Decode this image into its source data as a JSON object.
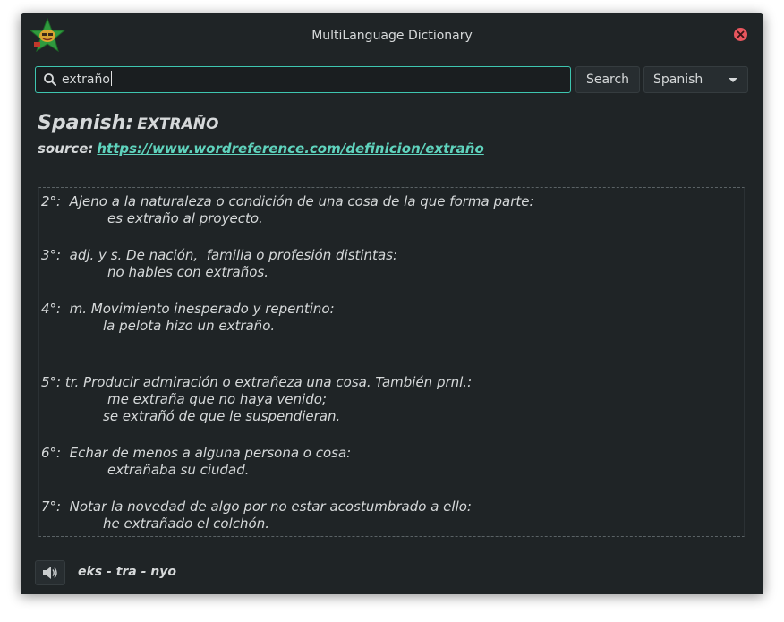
{
  "window": {
    "title": "MultiLanguage Dictionary"
  },
  "search": {
    "query": "extraño",
    "button_label": "Search",
    "language": "Spanish"
  },
  "result": {
    "language_label": "Spanish:",
    "word": "EXTRAÑO",
    "source_label": "source:",
    "source_url": "https://www.wordreference.com/definicion/extraño"
  },
  "definitions": [
    "2°:  Ajeno a la naturaleza o condición de una cosa de la que forma parte:",
    "es extraño al proyecto.",
    "3°:  adj. y s. De nación,  familia o profesión distintas:",
    "no hables con extraños.",
    "4°:  m. Movimiento inesperado y repentino:",
    "la pelota hizo un extraño.",
    "5°: tr. Producir admiración o extrañeza una cosa. También prnl.:",
    "me extraña que no haya venido;",
    "se extrañó de que le suspendieran.",
    "6°:  Echar de menos a alguna persona o cosa:",
    "extrañaba su ciudad.",
    "7°:  Notar la novedad de algo por no estar acostumbrado a ello:",
    "he extrañado el colchón."
  ],
  "pronunciation": "eks - tra - nyo",
  "icons": {
    "app": "star-face-icon",
    "close": "close-icon",
    "search": "search-icon",
    "dropdown": "chevron-down-icon",
    "speaker": "speaker-icon"
  },
  "colors": {
    "accent": "#3ec6b0",
    "link": "#5fd3bd",
    "close": "#e8565e",
    "background": "#1f2426"
  }
}
